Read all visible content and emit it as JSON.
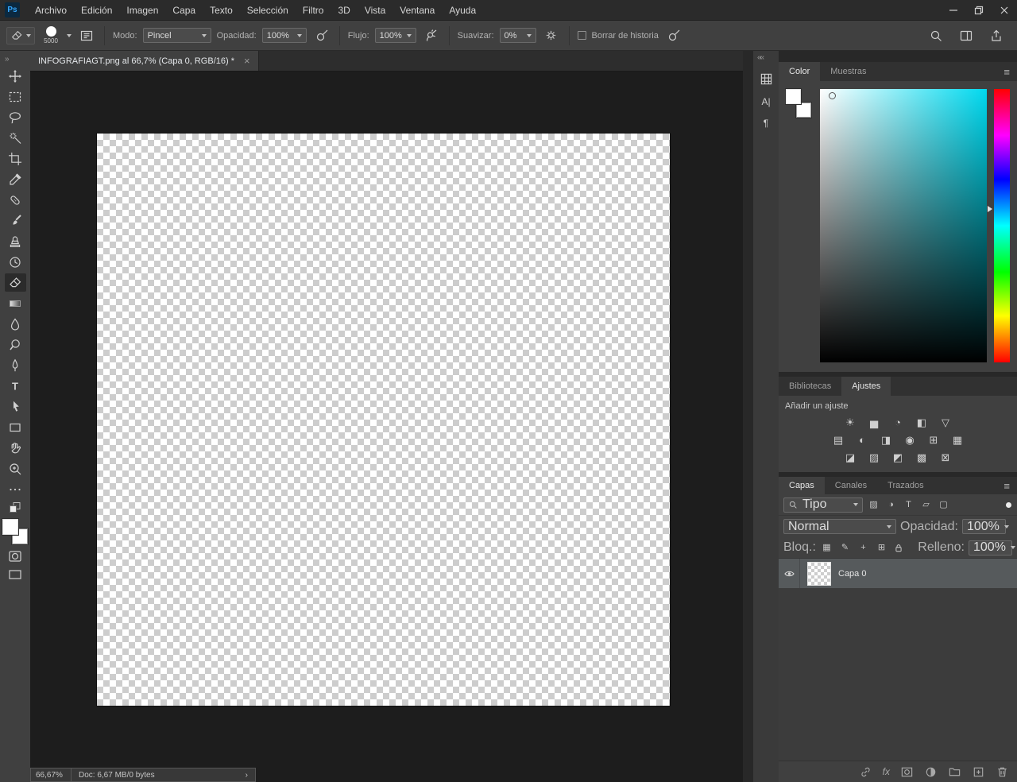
{
  "colors": {
    "accent_blue": "#34a8ff",
    "ps_logo_bg": "#0b2940",
    "panel_bg": "#404040",
    "canvas_bg": "#1d1d1d",
    "selected_layer_bg": "#565a5c",
    "field_hue": "#00d9ef"
  },
  "menubar": {
    "logo_text": "Ps",
    "items": [
      "Archivo",
      "Edición",
      "Imagen",
      "Capa",
      "Texto",
      "Selección",
      "Filtro",
      "3D",
      "Vista",
      "Ventana",
      "Ayuda"
    ]
  },
  "options_bar": {
    "brush_size": "5000",
    "mode_label": "Modo:",
    "mode_value": "Pincel",
    "opacity_label": "Opacidad:",
    "opacity_value": "100%",
    "flow_label": "Flujo:",
    "flow_value": "100%",
    "smoothing_label": "Suavizar:",
    "smoothing_value": "0%",
    "erase_history_label": "Borrar de historia"
  },
  "document_tab": {
    "title": "INFOGRAFIAGT.png al 66,7% (Capa 0, RGB/16) *",
    "close_icon": "×"
  },
  "left_strip": {
    "expand_chevron": "»"
  },
  "panel_strip": {
    "collapse_chevron": "««",
    "character_icon": "A|",
    "paragraph_icon": "¶"
  },
  "status_bar": {
    "zoom": "66,67%",
    "doc_info": "Doc: 6,67 MB/0 bytes",
    "chevron": "›"
  },
  "panels": {
    "color": {
      "tabs": [
        "Color",
        "Muestras"
      ],
      "menu_icon": "≡"
    },
    "adjustments": {
      "tabs": [
        "Bibliotecas",
        "Ajustes"
      ],
      "header": "Añadir un ajuste",
      "icons_row1": [
        "☀",
        "▅",
        "◔",
        "◧",
        "▽"
      ],
      "icons_row2": [
        "▤",
        "◐",
        "◨",
        "◉",
        "⊞",
        "▦"
      ],
      "icons_row3": [
        "◪",
        "▨",
        "◩",
        "▩",
        "⊠"
      ]
    },
    "layers": {
      "tabs": [
        "Capas",
        "Canales",
        "Trazados"
      ],
      "menu_icon": "≡",
      "filter_value": "Tipo",
      "filter_icons": [
        "▨",
        "◑",
        "T",
        "▱",
        "▢"
      ],
      "blend_value": "Normal",
      "opacity_label": "Opacidad:",
      "opacity_value": "100%",
      "lock_label": "Bloq.:",
      "lock_icons": [
        "▦",
        "✎",
        "+",
        "⊞"
      ],
      "fill_label": "Relleno:",
      "fill_value": "100%",
      "fx_label": "fx",
      "layer": {
        "name": "Capa 0"
      }
    }
  }
}
